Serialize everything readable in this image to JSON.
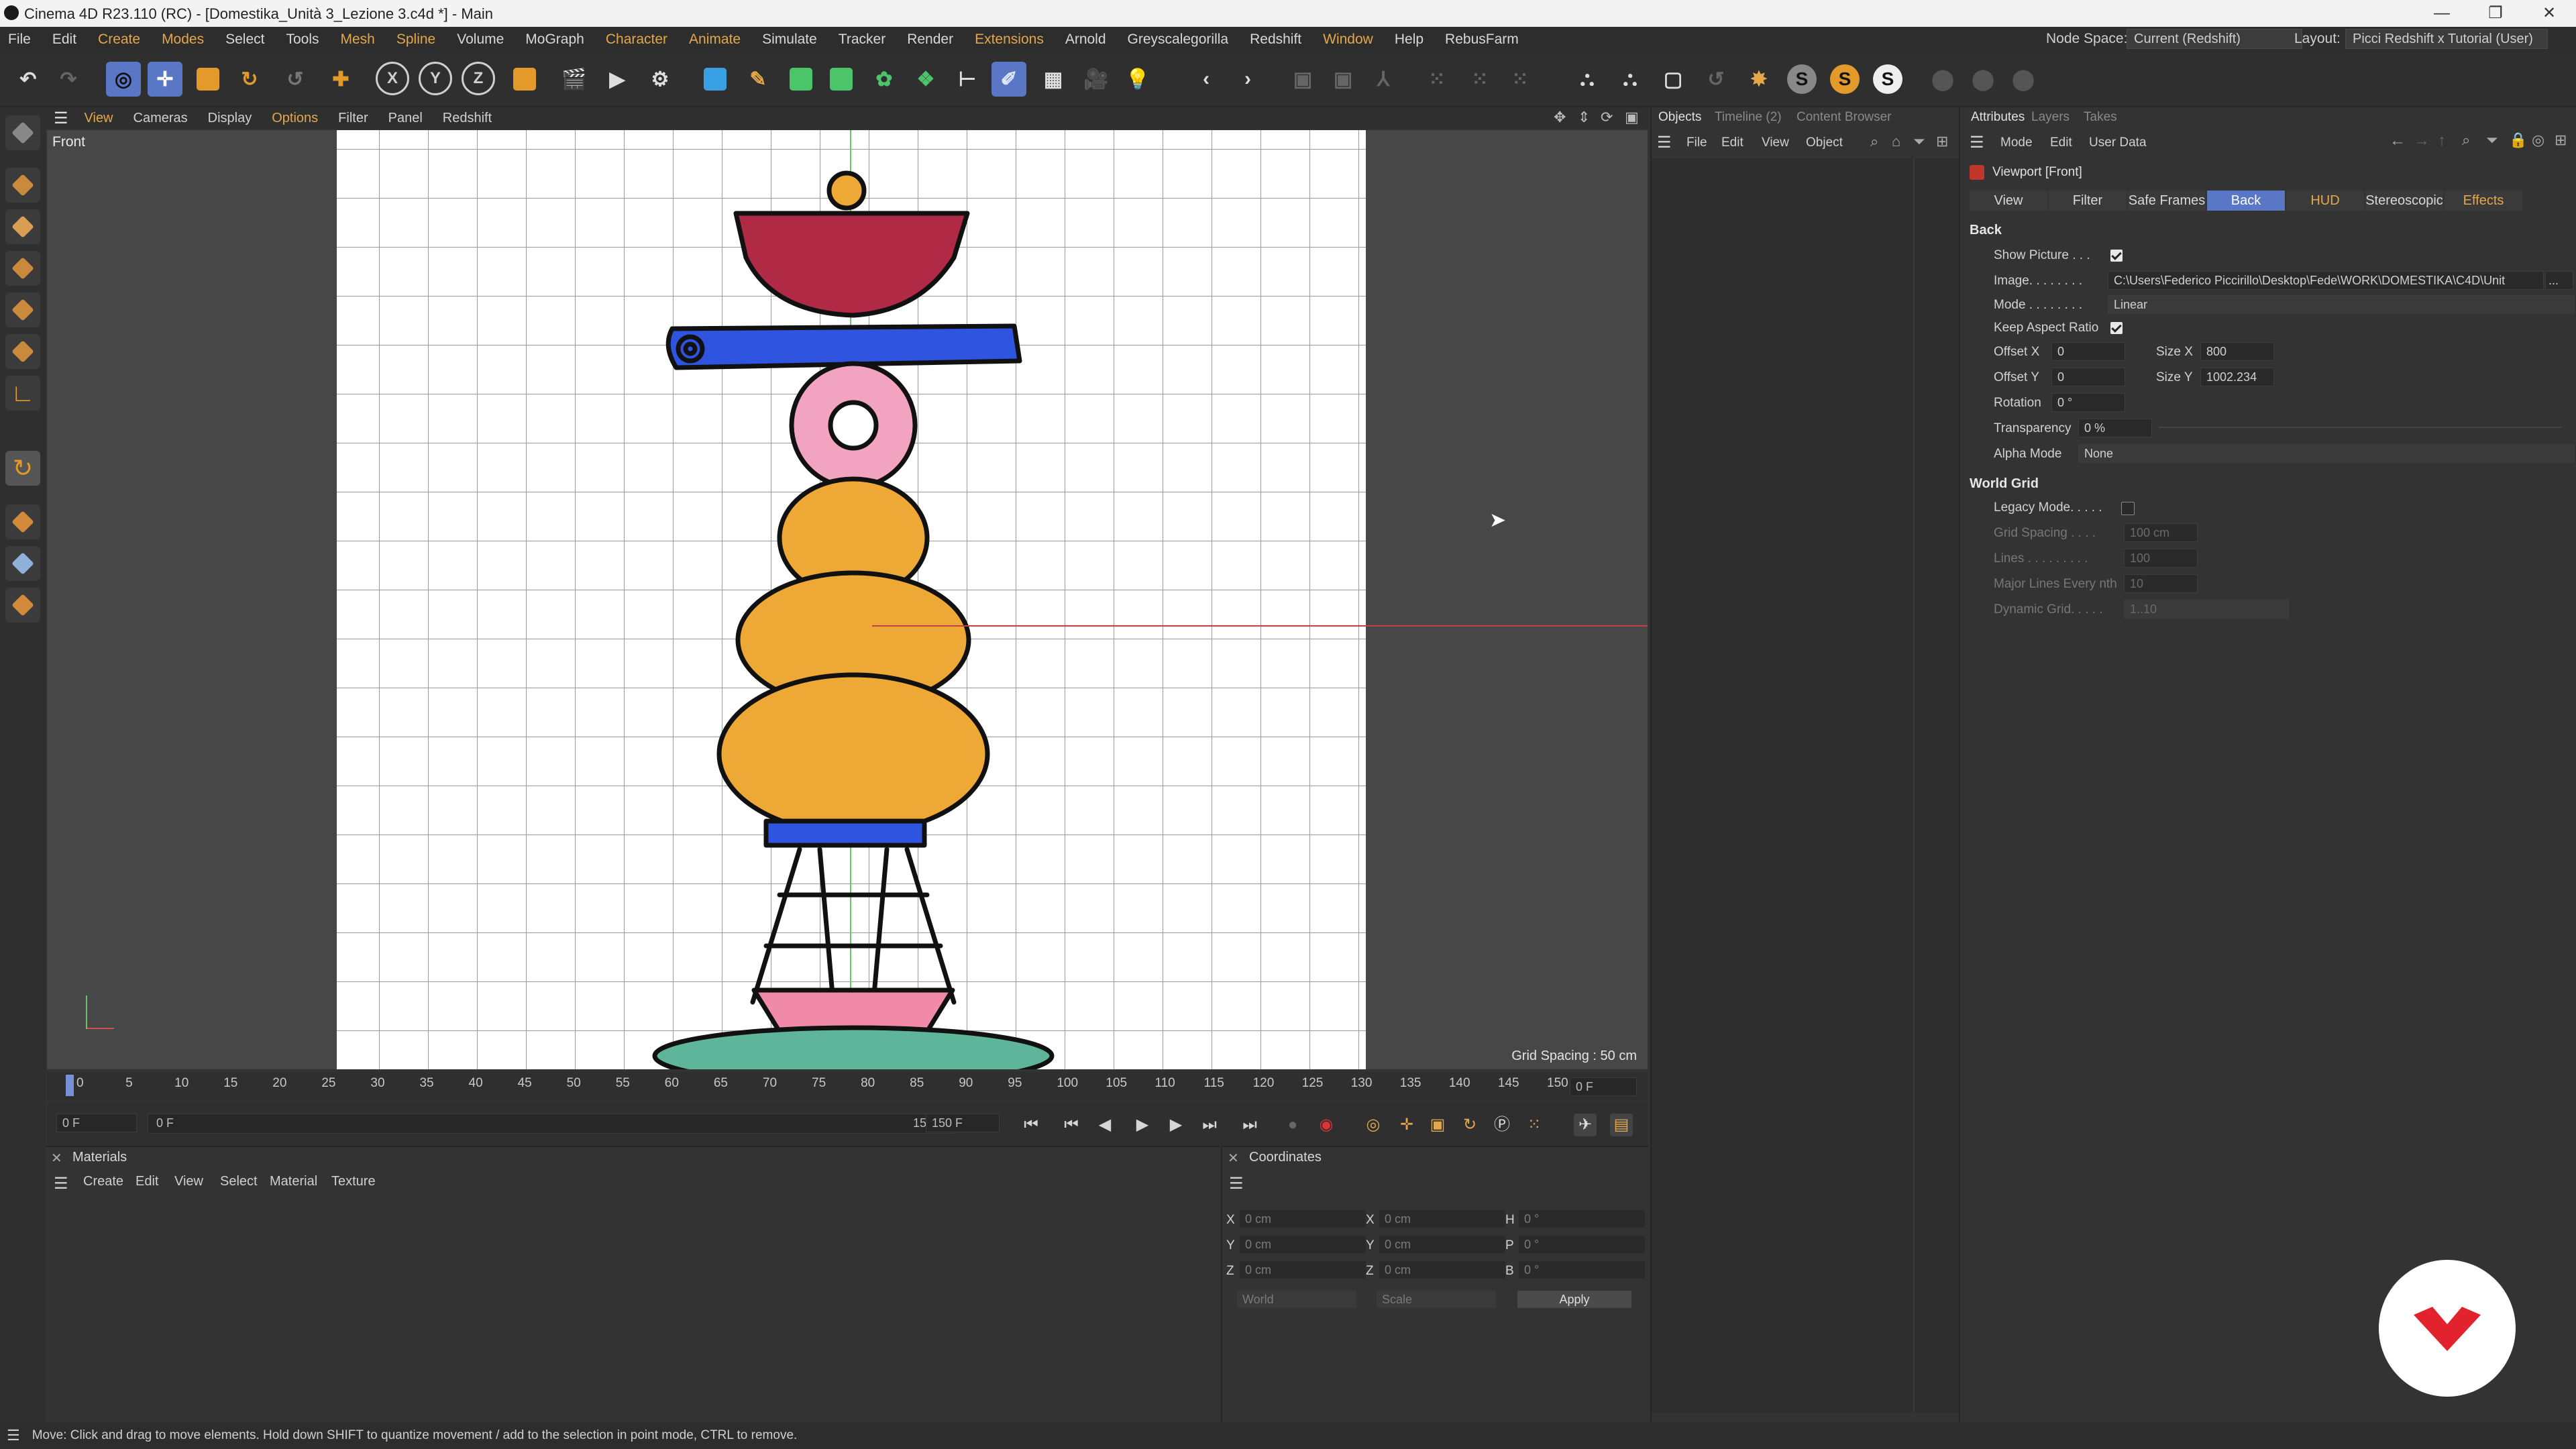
{
  "window": {
    "title": "Cinema 4D R23.110 (RC) - [Domestika_Unità 3_Lezione 3.c4d *] - Main",
    "controls": [
      "—",
      "❐",
      "✕"
    ]
  },
  "menubar": {
    "items": [
      "File",
      "Edit",
      "Create",
      "Modes",
      "Select",
      "Tools",
      "Mesh",
      "Spline",
      "Volume",
      "MoGraph",
      "Character",
      "Animate",
      "Simulate",
      "Tracker",
      "Render",
      "Extensions",
      "Arnold",
      "Greyscalegorilla",
      "Redshift",
      "Window",
      "Help",
      "RebusFarm"
    ],
    "highlighted": [
      "Create",
      "Modes",
      "Mesh",
      "Spline",
      "Character",
      "Animate",
      "Extensions",
      "Window"
    ],
    "node_space_label": "Node Space:",
    "node_space_value": "Current (Redshift)",
    "layout_label": "Layout:",
    "layout_value": "Picci Redshift x Tutorial (User)"
  },
  "toolbar": {
    "axis_x": "X",
    "axis_y": "Y",
    "axis_z": "Z",
    "s_buttons": [
      "S",
      "S",
      "S"
    ]
  },
  "viewport": {
    "menu": [
      "View",
      "Cameras",
      "Display",
      "Options",
      "Filter",
      "Panel",
      "Redshift"
    ],
    "camera_label": "Front",
    "grid_spacing": "Grid Spacing : 50 cm"
  },
  "timeline": {
    "ticks": [
      "0",
      "5",
      "10",
      "15",
      "20",
      "25",
      "30",
      "35",
      "40",
      "45",
      "50",
      "55",
      "60",
      "65",
      "70",
      "75",
      "80",
      "85",
      "90",
      "95",
      "100",
      "105",
      "110",
      "115",
      "120",
      "125",
      "130",
      "135",
      "140",
      "145",
      "150"
    ],
    "current_frame": "0 F",
    "start_frame": "0 F",
    "range_start": "0 F",
    "range_end": "150 F",
    "end_frame": "150 F"
  },
  "materials": {
    "title": "Materials",
    "menu": [
      "Create",
      "Edit",
      "View",
      "Select",
      "Material",
      "Texture"
    ]
  },
  "coordinates": {
    "title": "Coordinates",
    "rows": [
      {
        "a": "X",
        "av": "0 cm",
        "b": "X",
        "bv": "0 cm",
        "c": "H",
        "cv": "0 °"
      },
      {
        "a": "Y",
        "av": "0 cm",
        "b": "Y",
        "bv": "0 cm",
        "c": "P",
        "cv": "0 °"
      },
      {
        "a": "Z",
        "av": "0 cm",
        "b": "Z",
        "bv": "0 cm",
        "c": "B",
        "cv": "0 °"
      }
    ],
    "space": "World",
    "mode": "Scale",
    "apply": "Apply"
  },
  "objects": {
    "tabs": [
      "Objects",
      "Timeline (2)",
      "Content Browser"
    ],
    "menu": [
      "File",
      "Edit",
      "View",
      "Object"
    ]
  },
  "attributes": {
    "tabs": [
      "Attributes",
      "Layers",
      "Takes"
    ],
    "menu": [
      "Mode",
      "Edit",
      "User Data"
    ],
    "object_name": "Viewport [Front]",
    "subtabs": [
      "View",
      "Filter",
      "Safe Frames",
      "Back",
      "HUD",
      "Stereoscopic",
      "Effects"
    ],
    "active_subtab": "Back",
    "section_back": "Back",
    "show_picture_label": "Show Picture . . .",
    "show_picture": true,
    "image_label": "Image. . . . . . . .",
    "image_value": "C:\\Users\\Federico Piccirillo\\Desktop\\Fede\\WORK\\DOMESTIKA\\C4D\\Unit",
    "image_btn": "...",
    "mode_label": "Mode . . . . . . . .",
    "mode_value": "Linear",
    "keep_aspect_label": "Keep Aspect Ratio",
    "keep_aspect": true,
    "offset_x_label": "Offset X",
    "offset_x": "0",
    "size_x_label": "Size X",
    "size_x": "800",
    "offset_y_label": "Offset Y",
    "offset_y": "0",
    "size_y_label": "Size Y",
    "size_y": "1002.234",
    "rotation_label": "Rotation",
    "rotation": "0 °",
    "transparency_label": "Transparency",
    "transparency": "0 %",
    "alpha_mode_label": "Alpha Mode",
    "alpha_mode": "None",
    "section_world_grid": "World Grid",
    "legacy_label": "Legacy Mode. . . . .",
    "legacy": false,
    "grid_spacing_label": "Grid Spacing . . . .",
    "grid_spacing": "100 cm",
    "lines_label": "Lines . . . . . . . . .",
    "lines": "100",
    "major_label": "Major Lines Every nth",
    "major": "10",
    "dynamic_label": "Dynamic Grid. . . . .",
    "dynamic": "1..10"
  },
  "statusbar": {
    "text": "Move: Click and drag to move elements. Hold down SHIFT to quantize movement / add to the selection in point mode, CTRL to remove."
  },
  "colors": {
    "accent": "#5a77c6",
    "menu_highlight": "#e4a84b",
    "illustration": {
      "bowl": "#b02a45",
      "bar": "#2f54e0",
      "donut": "#f2a3c0",
      "yellow": "#eea836",
      "teal": "#5fb59a",
      "pink": "#f08aa8"
    }
  }
}
